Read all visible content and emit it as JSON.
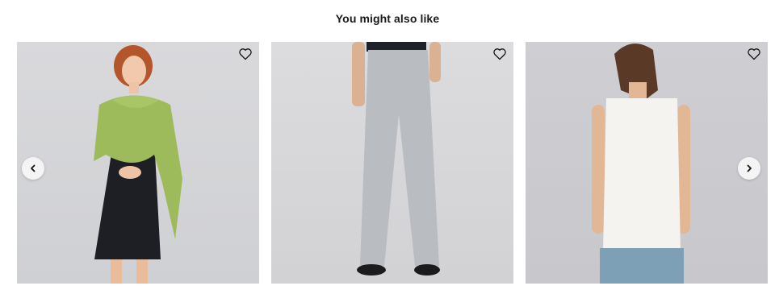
{
  "section": {
    "title": "You might also like"
  },
  "carousel": {
    "prev_icon": "chevron-left-icon",
    "next_icon": "chevron-right-icon",
    "products": [
      {
        "image_alt": "Green shawl over black dress",
        "wishlist_icon": "heart-outline-icon"
      },
      {
        "image_alt": "Grey wide-leg pants",
        "wishlist_icon": "heart-outline-icon"
      },
      {
        "image_alt": "White sleeveless top",
        "wishlist_icon": "heart-outline-icon"
      }
    ]
  },
  "colors": {
    "shawl": "#9dbb5a",
    "dress": "#1d1f24",
    "pants": "#b9bcc0",
    "top": "#f4f3ef",
    "jeans": "#7ea0b6"
  }
}
